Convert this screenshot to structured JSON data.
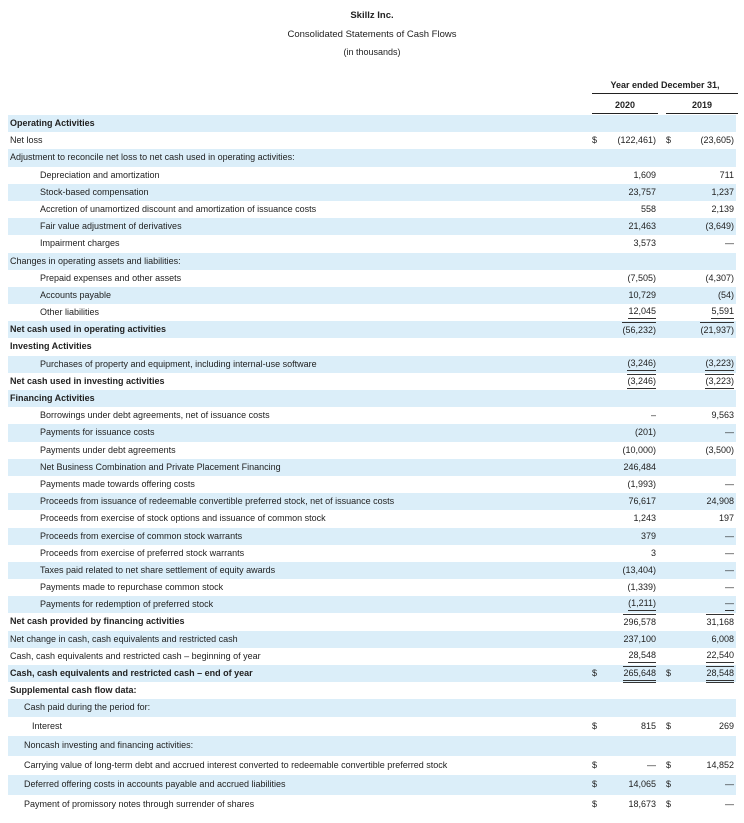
{
  "header": {
    "company": "Skillz Inc.",
    "statement": "Consolidated Statements of Cash Flows",
    "units": "(in thousands)",
    "year_heading": "Year ended December 31,",
    "col_2020": "2020",
    "col_2019": "2019",
    "currency_symbol": "$"
  },
  "rows": [
    {
      "label": "Operating Activities",
      "v2020": "",
      "v2019": "",
      "bold": true,
      "indent": 0,
      "shade": true
    },
    {
      "label": "Net loss",
      "v2020": "(122,461)",
      "v2019": "(23,605)",
      "indent": 0,
      "shade": false,
      "dollar": true
    },
    {
      "label": "Adjustment to reconcile net loss to net cash used in operating activities:",
      "v2020": "",
      "v2019": "",
      "indent": 0,
      "shade": true
    },
    {
      "label": "Depreciation and amortization",
      "v2020": "1,609",
      "v2019": "711",
      "indent": 1,
      "shade": false
    },
    {
      "label": "Stock-based compensation",
      "v2020": "23,757",
      "v2019": "1,237",
      "indent": 1,
      "shade": true
    },
    {
      "label": "Accretion of unamortized discount and amortization of issuance costs",
      "v2020": "558",
      "v2019": "2,139",
      "indent": 1,
      "shade": false
    },
    {
      "label": "Fair value adjustment of derivatives",
      "v2020": "21,463",
      "v2019": "(3,649)",
      "indent": 1,
      "shade": true
    },
    {
      "label": "Impairment charges",
      "v2020": "3,573",
      "v2019": "—",
      "indent": 1,
      "shade": false
    },
    {
      "label": "Changes in operating assets and liabilities:",
      "v2020": "",
      "v2019": "",
      "indent": 0,
      "shade": true
    },
    {
      "label": "Prepaid expenses and other assets",
      "v2020": "(7,505)",
      "v2019": "(4,307)",
      "indent": 1,
      "shade": false
    },
    {
      "label": "Accounts payable",
      "v2020": "10,729",
      "v2019": "(54)",
      "indent": 1,
      "shade": true
    },
    {
      "label": "Other liabilities",
      "v2020": "12,045",
      "v2019": "5,591",
      "indent": 1,
      "shade": false,
      "underline": true
    },
    {
      "label": "Net cash used in operating activities",
      "v2020": "(56,232)",
      "v2019": "(21,937)",
      "bold": true,
      "indent": 0,
      "shade": true
    },
    {
      "label": "Investing Activities",
      "v2020": "",
      "v2019": "",
      "bold": true,
      "indent": 0,
      "shade": false
    },
    {
      "label": "Purchases of property and equipment, including internal-use software",
      "v2020": "(3,246)",
      "v2019": "(3,223)",
      "indent": 1,
      "shade": true,
      "underline": true
    },
    {
      "label": "Net cash used in investing activities",
      "v2020": "(3,246)",
      "v2019": "(3,223)",
      "bold": true,
      "indent": 0,
      "shade": false,
      "doubleline": true
    },
    {
      "label": "Financing Activities",
      "v2020": "",
      "v2019": "",
      "bold": true,
      "indent": 0,
      "shade": true
    },
    {
      "label": "Borrowings under debt agreements, net of issuance costs",
      "v2020": "–",
      "v2019": "9,563",
      "indent": 1,
      "shade": false
    },
    {
      "label": "Payments for issuance costs",
      "v2020": "(201)",
      "v2019": "—",
      "indent": 1,
      "shade": true
    },
    {
      "label": "Payments under debt agreements",
      "v2020": "(10,000)",
      "v2019": "(3,500)",
      "indent": 1,
      "shade": false
    },
    {
      "label": "Net Business Combination and Private Placement Financing",
      "v2020": "246,484",
      "v2019": "",
      "indent": 1,
      "shade": true
    },
    {
      "label": "Payments made towards offering costs",
      "v2020": "(1,993)",
      "v2019": "—",
      "indent": 1,
      "shade": false
    },
    {
      "label": "Proceeds from issuance of redeemable convertible preferred stock, net of issuance costs",
      "v2020": "76,617",
      "v2019": "24,908",
      "indent": 1,
      "shade": true
    },
    {
      "label": "Proceeds from exercise of stock options and issuance of common stock",
      "v2020": "1,243",
      "v2019": "197",
      "indent": 1,
      "shade": false
    },
    {
      "label": "Proceeds from exercise of common stock warrants",
      "v2020": "379",
      "v2019": "—",
      "indent": 1,
      "shade": true
    },
    {
      "label": "Proceeds from exercise of preferred stock warrants",
      "v2020": "3",
      "v2019": "—",
      "indent": 1,
      "shade": false
    },
    {
      "label": "Taxes paid related to net share settlement of equity awards",
      "v2020": "(13,404)",
      "v2019": "—",
      "indent": 1,
      "shade": true
    },
    {
      "label": "Payments made to repurchase common stock",
      "v2020": "(1,339)",
      "v2019": "—",
      "indent": 1,
      "shade": false
    },
    {
      "label": "Payments for redemption of preferred stock",
      "v2020": "(1,211)",
      "v2019": "—",
      "indent": 1,
      "shade": true,
      "underline": true
    },
    {
      "label": "Net cash provided by financing activities",
      "v2020": "296,578",
      "v2019": "31,168",
      "bold": true,
      "indent": 0,
      "shade": false
    },
    {
      "label": "Net change in cash, cash equivalents and restricted cash",
      "v2020": "237,100",
      "v2019": "6,008",
      "indent": 0,
      "shade": true
    },
    {
      "label": "Cash, cash equivalents and restricted cash – beginning of year",
      "v2020": "28,548",
      "v2019": "22,540",
      "indent": 0,
      "shade": false,
      "underline": true
    },
    {
      "label": "Cash, cash equivalents and restricted cash – end of year",
      "v2020": "265,648",
      "v2019": "28,548",
      "bold": true,
      "indent": 0,
      "shade": true,
      "dollar": true,
      "doubleline": true
    },
    {
      "label": "Supplemental cash flow data:",
      "v2020": "",
      "v2019": "",
      "bold": true,
      "indent": 0,
      "shade": false
    },
    {
      "label": "Cash paid during the period for:",
      "v2020": "",
      "v2019": "",
      "indent": "s1",
      "shade": true
    },
    {
      "label": "Interest",
      "v2020": "815",
      "v2019": "269",
      "indent": "s2",
      "shade": false,
      "dollar": true,
      "tall": true
    },
    {
      "label": "Noncash investing and financing activities:",
      "v2020": "",
      "v2019": "",
      "indent": "s1",
      "shade": true,
      "tall": true
    },
    {
      "label": "Carrying value of long-term debt and accrued interest converted to redeemable convertible preferred stock",
      "v2020": "—",
      "v2019": "14,852",
      "indent": "s1",
      "shade": false,
      "dollar": true,
      "tall": true
    },
    {
      "label": "Deferred offering costs in accounts payable and accrued liabilities",
      "v2020": "14,065",
      "v2019": "—",
      "indent": "s1",
      "shade": true,
      "dollar": true,
      "tall": true
    },
    {
      "label": "Payment of promissory notes through surrender of shares",
      "v2020": "18,673",
      "v2019": "—",
      "indent": "s1",
      "shade": false,
      "dollar": true,
      "tall": true
    }
  ]
}
